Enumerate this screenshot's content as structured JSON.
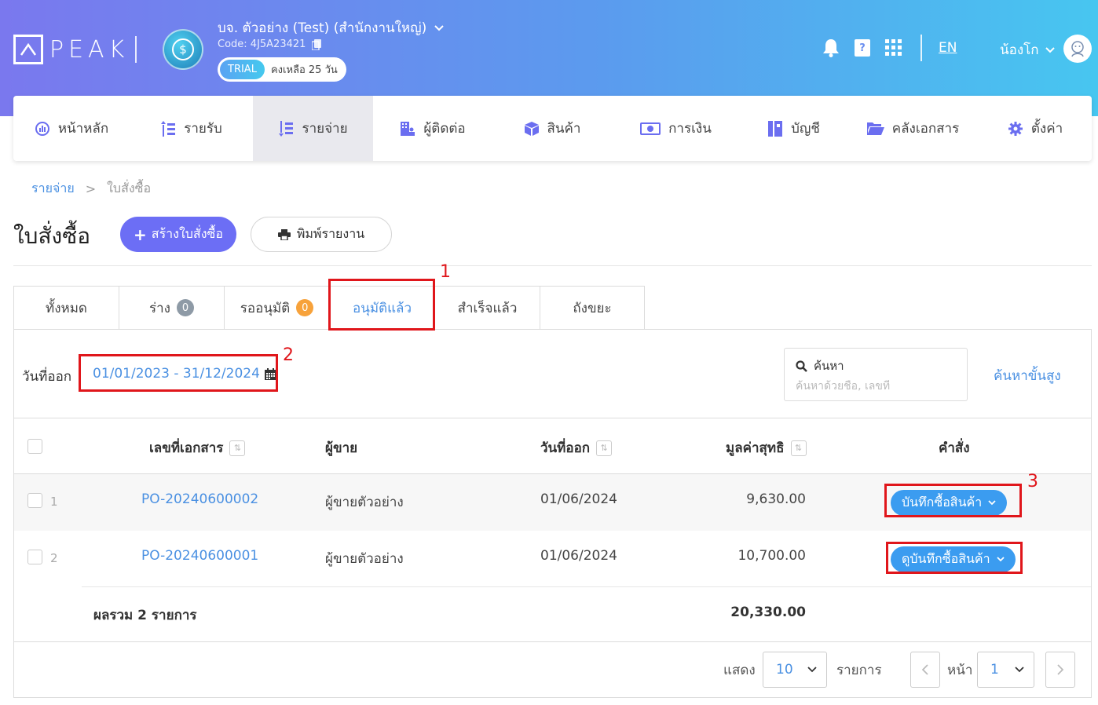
{
  "header": {
    "logo_text": "PEAK",
    "company_name": "บจ. ตัวอย่าง (Test) (สำนักงานใหญ่)",
    "company_code": "Code: 4J5A23421",
    "trial_badge": "TRIAL",
    "trial_remaining": "คงเหลือ 25 วัน",
    "language": "EN",
    "user_name": "น้องโก"
  },
  "nav": {
    "items": [
      {
        "label": "หน้าหลัก",
        "icon": "dashboard-icon"
      },
      {
        "label": "รายรับ",
        "icon": "income-icon"
      },
      {
        "label": "รายจ่าย",
        "icon": "expense-icon",
        "active": true
      },
      {
        "label": "ผู้ติดต่อ",
        "icon": "contacts-icon"
      },
      {
        "label": "สินค้า",
        "icon": "box-icon"
      },
      {
        "label": "การเงิน",
        "icon": "money-icon"
      },
      {
        "label": "บัญชี",
        "icon": "book-icon"
      },
      {
        "label": "คลังเอกสาร",
        "icon": "folder-icon"
      },
      {
        "label": "ตั้งค่า",
        "icon": "gear-icon"
      }
    ]
  },
  "breadcrumb": {
    "parent": "รายจ่าย",
    "separator": ">",
    "current": "ใบสั่งซื้อ"
  },
  "page": {
    "title": "ใบสั่งซื้อ",
    "create_label": "สร้างใบสั่งซื้อ",
    "print_label": "พิมพ์รายงาน"
  },
  "tabs": [
    {
      "label": "ทั้งหมด"
    },
    {
      "label": "ร่าง",
      "count": "0"
    },
    {
      "label": "รออนุมัติ",
      "count": "0"
    },
    {
      "label": "อนุมัติแล้ว",
      "active": true
    },
    {
      "label": "สำเร็จแล้ว"
    },
    {
      "label": "ถังขยะ"
    }
  ],
  "filter": {
    "date_label": "วันที่ออก",
    "date_range": "01/01/2023 - 31/12/2024",
    "search_title": "ค้นหา",
    "search_placeholder": "ค้นหาด้วยชื่อ, เลขที่",
    "advanced_search": "ค้นหาขั้นสูง"
  },
  "table": {
    "headers": {
      "doc_no": "เลขที่เอกสาร",
      "vendor": "ผู้ขาย",
      "issue_date": "วันที่ออก",
      "net_value": "มูลค่าสุทธิ",
      "action": "คำสั่ง"
    },
    "rows": [
      {
        "num": "1",
        "doc_no": "PO-20240600002",
        "vendor": "ผู้ขายตัวอย่าง",
        "issue_date": "01/06/2024",
        "net_value": "9,630.00",
        "action": "บันทึกซื้อสินค้า"
      },
      {
        "num": "2",
        "doc_no": "PO-20240600001",
        "vendor": "ผู้ขายตัวอย่าง",
        "issue_date": "01/06/2024",
        "net_value": "10,700.00",
        "action": "ดูบันทึกซื้อสินค้า"
      }
    ],
    "total_label": "ผลรวม 2 รายการ",
    "total_value": "20,330.00"
  },
  "pagination": {
    "show_label": "แสดง",
    "per_page": "10",
    "items_label": "รายการ",
    "page_label": "หน้า",
    "page": "1"
  },
  "annotations": [
    "1",
    "2",
    "3"
  ],
  "colors": {
    "accent": "#4a90e2",
    "primary_button": "#6c6ef5",
    "action_button": "#3b9cf0",
    "highlight": "#e0161b"
  }
}
